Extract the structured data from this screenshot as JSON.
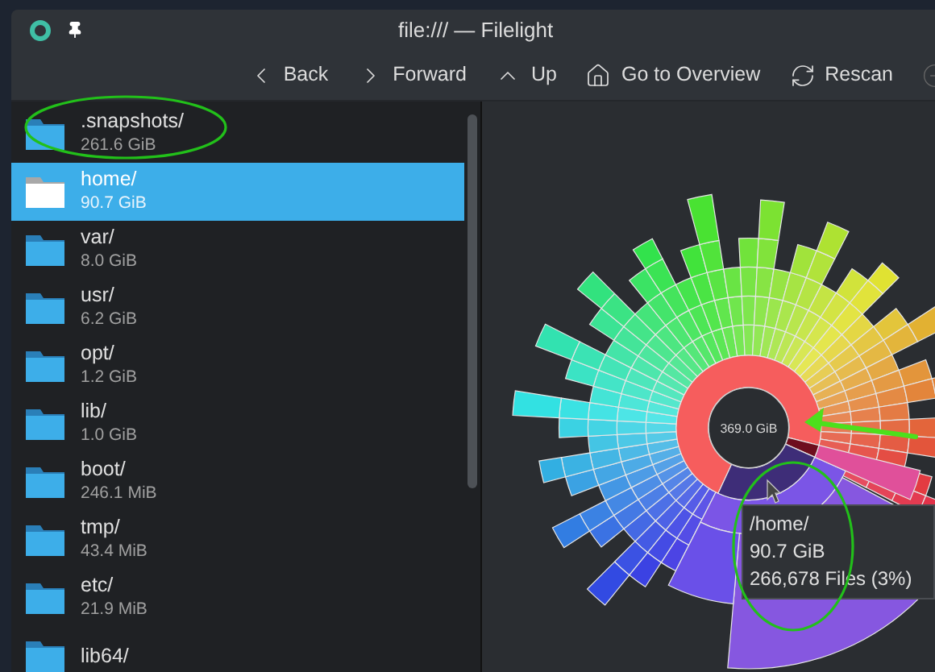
{
  "window": {
    "title": "file:/// — Filelight"
  },
  "toolbar": [
    {
      "label": "Back",
      "kind": "back"
    },
    {
      "label": "Forward",
      "kind": "forward"
    },
    {
      "label": "Up",
      "kind": "up"
    },
    {
      "label": "Go to Overview",
      "kind": "overview"
    },
    {
      "label": "Rescan",
      "kind": "rescan"
    }
  ],
  "folders": [
    {
      "name": ".snapshots/",
      "size": "261.6 GiB",
      "selected": false
    },
    {
      "name": "home/",
      "size": "90.7 GiB",
      "selected": true
    },
    {
      "name": "var/",
      "size": "8.0 GiB",
      "selected": false
    },
    {
      "name": "usr/",
      "size": "6.2 GiB",
      "selected": false
    },
    {
      "name": "opt/",
      "size": "1.2 GiB",
      "selected": false
    },
    {
      "name": "lib/",
      "size": "1.0 GiB",
      "selected": false
    },
    {
      "name": "boot/",
      "size": "246.1 MiB",
      "selected": false
    },
    {
      "name": "tmp/",
      "size": "43.4 MiB",
      "selected": false
    },
    {
      "name": "etc/",
      "size": "21.9 MiB",
      "selected": false
    },
    {
      "name": "lib64/",
      "selected": false
    }
  ],
  "chart": {
    "center_label": "369.0 GiB",
    "tooltip": [
      "/home/",
      "90.7 GiB",
      "266,678 Files (3%)"
    ]
  }
}
